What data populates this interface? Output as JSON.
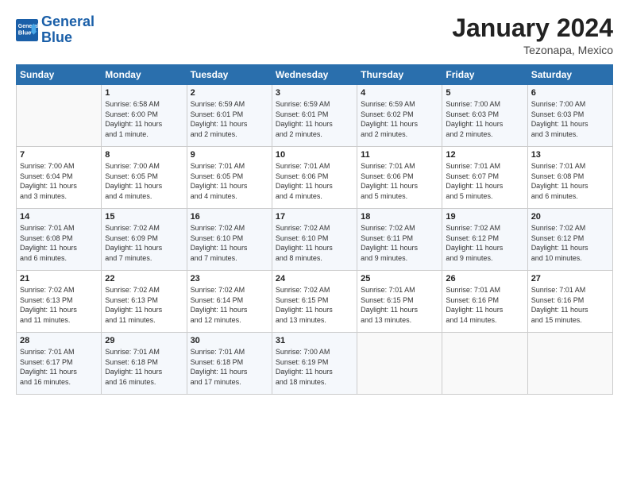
{
  "logo": {
    "text_general": "General",
    "text_blue": "Blue"
  },
  "header": {
    "month": "January 2024",
    "location": "Tezonapa, Mexico"
  },
  "weekdays": [
    "Sunday",
    "Monday",
    "Tuesday",
    "Wednesday",
    "Thursday",
    "Friday",
    "Saturday"
  ],
  "weeks": [
    [
      {
        "day": "",
        "info": ""
      },
      {
        "day": "1",
        "info": "Sunrise: 6:58 AM\nSunset: 6:00 PM\nDaylight: 11 hours\nand 1 minute."
      },
      {
        "day": "2",
        "info": "Sunrise: 6:59 AM\nSunset: 6:01 PM\nDaylight: 11 hours\nand 2 minutes."
      },
      {
        "day": "3",
        "info": "Sunrise: 6:59 AM\nSunset: 6:01 PM\nDaylight: 11 hours\nand 2 minutes."
      },
      {
        "day": "4",
        "info": "Sunrise: 6:59 AM\nSunset: 6:02 PM\nDaylight: 11 hours\nand 2 minutes."
      },
      {
        "day": "5",
        "info": "Sunrise: 7:00 AM\nSunset: 6:03 PM\nDaylight: 11 hours\nand 2 minutes."
      },
      {
        "day": "6",
        "info": "Sunrise: 7:00 AM\nSunset: 6:03 PM\nDaylight: 11 hours\nand 3 minutes."
      }
    ],
    [
      {
        "day": "7",
        "info": "Sunrise: 7:00 AM\nSunset: 6:04 PM\nDaylight: 11 hours\nand 3 minutes."
      },
      {
        "day": "8",
        "info": "Sunrise: 7:00 AM\nSunset: 6:05 PM\nDaylight: 11 hours\nand 4 minutes."
      },
      {
        "day": "9",
        "info": "Sunrise: 7:01 AM\nSunset: 6:05 PM\nDaylight: 11 hours\nand 4 minutes."
      },
      {
        "day": "10",
        "info": "Sunrise: 7:01 AM\nSunset: 6:06 PM\nDaylight: 11 hours\nand 4 minutes."
      },
      {
        "day": "11",
        "info": "Sunrise: 7:01 AM\nSunset: 6:06 PM\nDaylight: 11 hours\nand 5 minutes."
      },
      {
        "day": "12",
        "info": "Sunrise: 7:01 AM\nSunset: 6:07 PM\nDaylight: 11 hours\nand 5 minutes."
      },
      {
        "day": "13",
        "info": "Sunrise: 7:01 AM\nSunset: 6:08 PM\nDaylight: 11 hours\nand 6 minutes."
      }
    ],
    [
      {
        "day": "14",
        "info": "Sunrise: 7:01 AM\nSunset: 6:08 PM\nDaylight: 11 hours\nand 6 minutes."
      },
      {
        "day": "15",
        "info": "Sunrise: 7:02 AM\nSunset: 6:09 PM\nDaylight: 11 hours\nand 7 minutes."
      },
      {
        "day": "16",
        "info": "Sunrise: 7:02 AM\nSunset: 6:10 PM\nDaylight: 11 hours\nand 7 minutes."
      },
      {
        "day": "17",
        "info": "Sunrise: 7:02 AM\nSunset: 6:10 PM\nDaylight: 11 hours\nand 8 minutes."
      },
      {
        "day": "18",
        "info": "Sunrise: 7:02 AM\nSunset: 6:11 PM\nDaylight: 11 hours\nand 9 minutes."
      },
      {
        "day": "19",
        "info": "Sunrise: 7:02 AM\nSunset: 6:12 PM\nDaylight: 11 hours\nand 9 minutes."
      },
      {
        "day": "20",
        "info": "Sunrise: 7:02 AM\nSunset: 6:12 PM\nDaylight: 11 hours\nand 10 minutes."
      }
    ],
    [
      {
        "day": "21",
        "info": "Sunrise: 7:02 AM\nSunset: 6:13 PM\nDaylight: 11 hours\nand 11 minutes."
      },
      {
        "day": "22",
        "info": "Sunrise: 7:02 AM\nSunset: 6:13 PM\nDaylight: 11 hours\nand 11 minutes."
      },
      {
        "day": "23",
        "info": "Sunrise: 7:02 AM\nSunset: 6:14 PM\nDaylight: 11 hours\nand 12 minutes."
      },
      {
        "day": "24",
        "info": "Sunrise: 7:02 AM\nSunset: 6:15 PM\nDaylight: 11 hours\nand 13 minutes."
      },
      {
        "day": "25",
        "info": "Sunrise: 7:01 AM\nSunset: 6:15 PM\nDaylight: 11 hours\nand 13 minutes."
      },
      {
        "day": "26",
        "info": "Sunrise: 7:01 AM\nSunset: 6:16 PM\nDaylight: 11 hours\nand 14 minutes."
      },
      {
        "day": "27",
        "info": "Sunrise: 7:01 AM\nSunset: 6:16 PM\nDaylight: 11 hours\nand 15 minutes."
      }
    ],
    [
      {
        "day": "28",
        "info": "Sunrise: 7:01 AM\nSunset: 6:17 PM\nDaylight: 11 hours\nand 16 minutes."
      },
      {
        "day": "29",
        "info": "Sunrise: 7:01 AM\nSunset: 6:18 PM\nDaylight: 11 hours\nand 16 minutes."
      },
      {
        "day": "30",
        "info": "Sunrise: 7:01 AM\nSunset: 6:18 PM\nDaylight: 11 hours\nand 17 minutes."
      },
      {
        "day": "31",
        "info": "Sunrise: 7:00 AM\nSunset: 6:19 PM\nDaylight: 11 hours\nand 18 minutes."
      },
      {
        "day": "",
        "info": ""
      },
      {
        "day": "",
        "info": ""
      },
      {
        "day": "",
        "info": ""
      }
    ]
  ]
}
